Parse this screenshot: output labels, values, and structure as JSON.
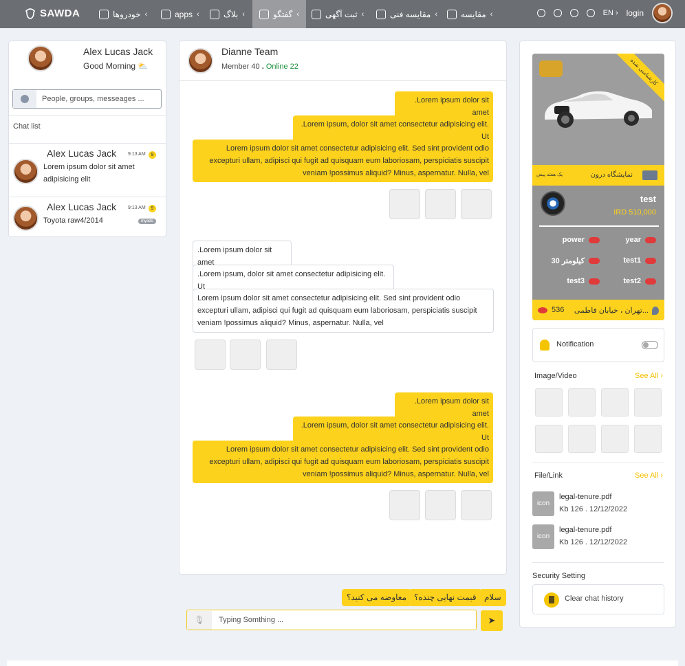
{
  "nav": {
    "brand": "SAWDA",
    "items": [
      {
        "label": "خودروها"
      },
      {
        "label": "apps"
      },
      {
        "label": "بلاگ"
      },
      {
        "label": "گفتگو"
      },
      {
        "label": "ثبت آگهی"
      },
      {
        "label": "مقایسه فنی"
      },
      {
        "label": "مقایسه"
      }
    ],
    "lang": "EN",
    "login": "login"
  },
  "left": {
    "user_name": "Alex Lucas Jack",
    "greeting": "Good Morning",
    "search_placeholder": "People, groups, messeages ...",
    "chat_list_label": "Chat list",
    "chats": [
      {
        "name": "Alex Lucas Jack",
        "time": "9:13 AM",
        "unread": "9",
        "message": "Lorem ipsum dolor sit amet adipisicing elit"
      },
      {
        "name": "Alex Lucas Jack",
        "time": "9:13 AM",
        "unread": "9",
        "message": "Toyota raw4/2014",
        "tag": "myads"
      }
    ]
  },
  "chat": {
    "title": "Dianne Team",
    "members": "Member 40",
    "sep": ".",
    "online": "Online 22",
    "msg_short": ".Lorem ipsum dolor sit amet",
    "msg_medium": ".Lorem ipsum, dolor sit amet consectetur adipisicing elit. Ut",
    "msg_long": "Lorem ipsum dolor sit amet consectetur adipisicing elit. Sed sint provident odio excepturi ullam, adipisci qui fugit ad quisquam eum laboriosam, perspiciatis suscipit veniam !possimus aliquid? Minus, aspernatur. Nulla, vel",
    "quick_replies": [
      "سلام",
      "قیمت نهایی چنده؟",
      "معاوضه می کنید؟"
    ],
    "input_placeholder": "Typing Somthing ..."
  },
  "card": {
    "ribbon": "کارشناسی شده",
    "showroom": "نمایشگاه درون",
    "showroom_sub": "یک هفته پیش",
    "title": "test",
    "price": "IRD 510,000",
    "specs": [
      "year",
      "power",
      "test1",
      "30 کیلومتر",
      "test2",
      "test3"
    ],
    "location": "تهران ، خیابان فاطمی...",
    "views": "536"
  },
  "right": {
    "notification": "Notification",
    "media_label": "Image/Video",
    "see_all": "See All",
    "files_label": "File/Link",
    "files": [
      {
        "icon": "icon",
        "name": "legal-tenure.pdf",
        "meta": "Kb 126 . 12/12/2022"
      },
      {
        "icon": "icon",
        "name": "legal-tenure.pdf",
        "meta": "Kb 126 . 12/12/2022"
      }
    ],
    "security_label": "Security Setting",
    "clear_history": "Clear chat history"
  }
}
